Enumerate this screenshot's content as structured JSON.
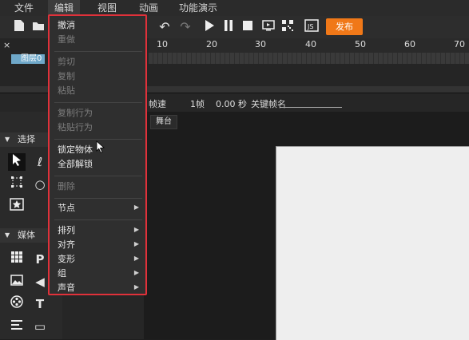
{
  "menubar": {
    "items": [
      "文件",
      "编辑",
      "视图",
      "动画",
      "功能演示"
    ]
  },
  "toolbar": {
    "publish_label": "发布",
    "icons": [
      "new-file-icon",
      "open-folder-icon",
      "undo-icon",
      "redo-icon",
      "play-icon",
      "pause-icon",
      "stop-icon",
      "preview-icon",
      "qrcode-icon",
      "js-icon"
    ]
  },
  "timeline": {
    "ruler": [
      "10",
      "20",
      "30",
      "40",
      "50",
      "60",
      "70"
    ],
    "layer_name": "图层0"
  },
  "properties": {
    "speed_label": "帧速",
    "frame_value": "1帧",
    "time_value": "0.00 秒",
    "keyframe_label": "关键帧名"
  },
  "left_panel": {
    "select_header": "选择",
    "media_header": "媒体"
  },
  "stage": {
    "tab_label": "舞台"
  },
  "edit_menu": {
    "items": [
      {
        "label": "撤消",
        "disabled": false,
        "submenu": false
      },
      {
        "label": "重做",
        "disabled": true,
        "submenu": false
      },
      {
        "label": "剪切",
        "disabled": true,
        "submenu": false
      },
      {
        "label": "复制",
        "disabled": true,
        "submenu": false
      },
      {
        "label": "粘贴",
        "disabled": true,
        "submenu": false
      },
      {
        "label": "复制行为",
        "disabled": true,
        "submenu": false
      },
      {
        "label": "粘贴行为",
        "disabled": true,
        "submenu": false
      },
      {
        "label": "锁定物体",
        "disabled": false,
        "submenu": false
      },
      {
        "label": "全部解锁",
        "disabled": false,
        "submenu": false
      },
      {
        "label": "删除",
        "disabled": true,
        "submenu": false
      },
      {
        "label": "节点",
        "disabled": false,
        "submenu": true
      },
      {
        "label": "排列",
        "disabled": false,
        "submenu": true
      },
      {
        "label": "对齐",
        "disabled": false,
        "submenu": true
      },
      {
        "label": "变形",
        "disabled": false,
        "submenu": true
      },
      {
        "label": "组",
        "disabled": false,
        "submenu": true
      },
      {
        "label": "声音",
        "disabled": false,
        "submenu": true
      }
    ]
  },
  "colors": {
    "accent": "#f07818",
    "highlight_border": "#e0313a"
  }
}
